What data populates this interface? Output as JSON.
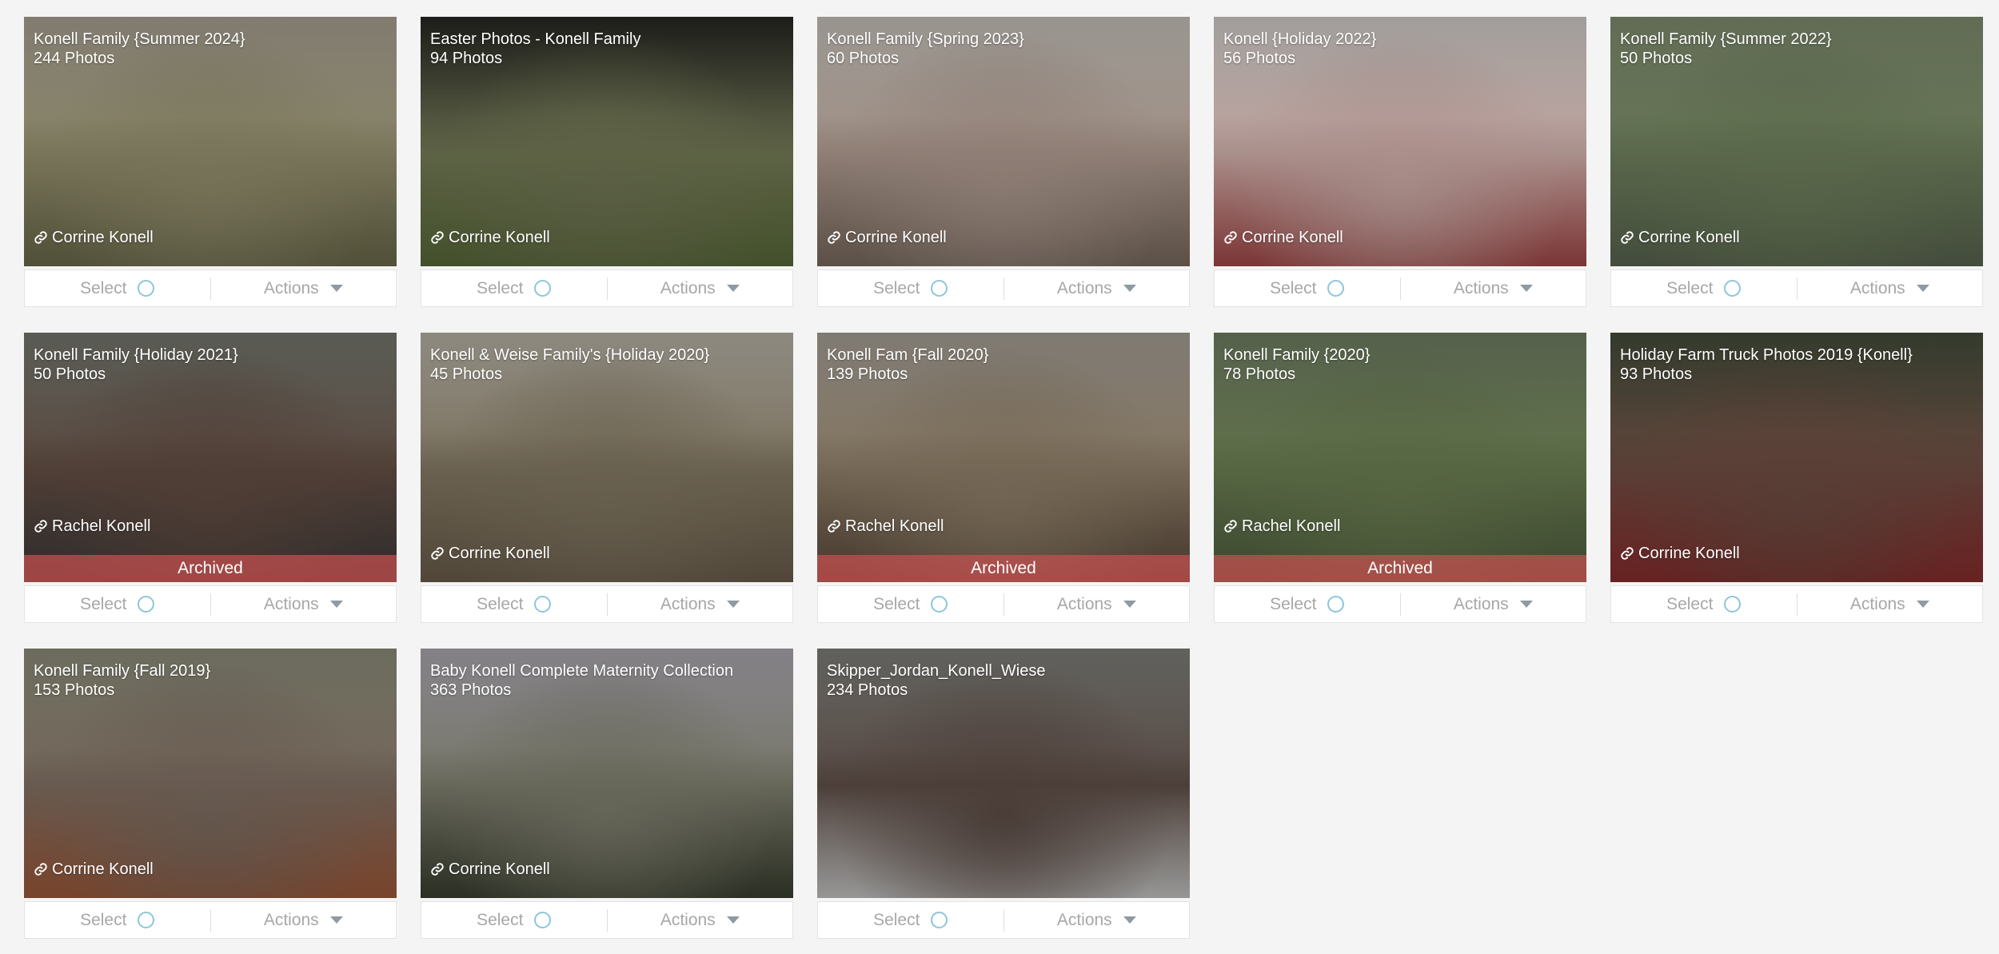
{
  "labels": {
    "select": "Select",
    "actions": "Actions",
    "archived": "Archived"
  },
  "galleries": [
    {
      "title": "Konell Family {Summer 2024}",
      "count": "244 Photos",
      "owner": "Corrine Konell",
      "archived": false,
      "colors": [
        "#b9b0a0",
        "#8e8a6a",
        "#6b6a4a"
      ]
    },
    {
      "title": "Easter Photos - Konell Family",
      "count": "94 Photos",
      "owner": "Corrine Konell",
      "archived": false,
      "colors": [
        "#2a2a26",
        "#6e7452",
        "#5a6b3a"
      ]
    },
    {
      "title": "Konell Family {Spring 2023}",
      "count": "60 Photos",
      "owner": "Corrine Konell",
      "archived": false,
      "colors": [
        "#d9d4cc",
        "#a8958a",
        "#7a6a5e"
      ]
    },
    {
      "title": "Konell {Holiday 2022}",
      "count": "56 Photos",
      "owner": "Corrine Konell",
      "archived": false,
      "colors": [
        "#e6e2de",
        "#c9a9a4",
        "#a44848"
      ]
    },
    {
      "title": "Konell Family {Summer 2022}",
      "count": "50 Photos",
      "owner": "Corrine Konell",
      "archived": false,
      "colors": [
        "#8c9a7a",
        "#6a7a58",
        "#5a6650"
      ]
    },
    {
      "title": "Konell Family {Holiday 2021}",
      "count": "50 Photos",
      "owner": "Rachel Konell",
      "archived": true,
      "colors": [
        "#7f8278",
        "#5e4a40",
        "#3e3a3a"
      ]
    },
    {
      "title": "Konell & Weise Family's {Holiday 2020}",
      "count": "45 Photos",
      "owner": "Corrine Konell",
      "archived": false,
      "colors": [
        "#c9c3b5",
        "#7d735e",
        "#6c5e4c"
      ]
    },
    {
      "title": "Konell Fam {Fall 2020}",
      "count": "139 Photos",
      "owner": "Rachel Konell",
      "archived": true,
      "colors": [
        "#b5aea3",
        "#8a7a64",
        "#5a4a3c"
      ]
    },
    {
      "title": "Konell Family {2020}",
      "count": "78 Photos",
      "owner": "Rachel Konell",
      "archived": true,
      "colors": [
        "#7a8a6c",
        "#66784e",
        "#4e5e3e"
      ]
    },
    {
      "title": "Holiday Farm Truck Photos 2019 {Konell}",
      "count": "93 Photos",
      "owner": "Corrine Konell",
      "archived": false,
      "colors": [
        "#4a5440",
        "#6a4a40",
        "#8a2c2c"
      ]
    },
    {
      "title": "Konell Family {Fall 2019}",
      "count": "153 Photos",
      "owner": "Corrine Konell",
      "archived": false,
      "colors": [
        "#9a9a86",
        "#7a6a5e",
        "#a05a3a"
      ]
    },
    {
      "title": "Baby Konell Complete Maternity Collection",
      "count": "363 Photos",
      "owner": "Corrine Konell",
      "archived": false,
      "colors": [
        "#bcb8c0",
        "#7a7a6a",
        "#3a4030"
      ]
    },
    {
      "title": "Skipper_Jordan_Konell_Wiese",
      "count": "234 Photos",
      "owner": "",
      "archived": false,
      "colors": [
        "#8a8a84",
        "#5a4a44",
        "#c8c8c6"
      ]
    }
  ]
}
